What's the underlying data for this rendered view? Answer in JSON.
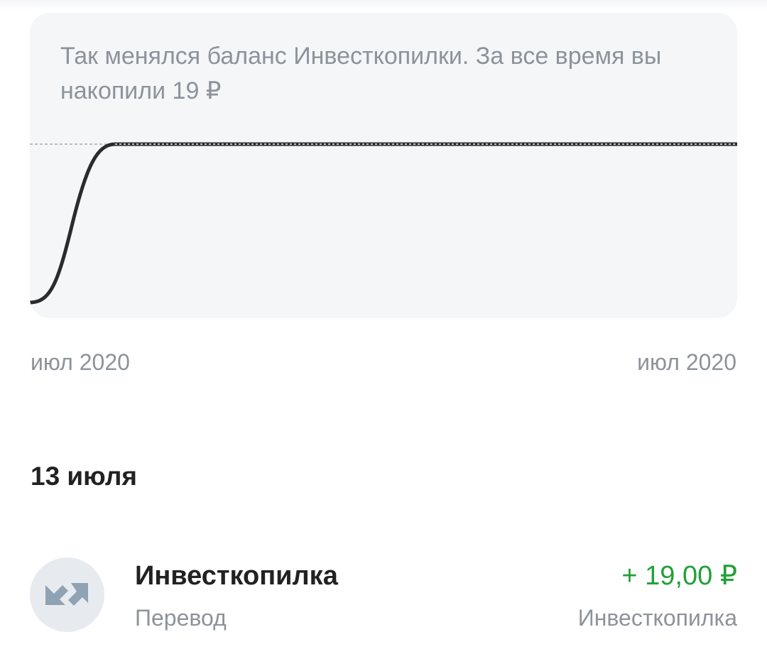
{
  "chart_card": {
    "caption": "Так менялся баланс Инвесткопилки. За все время вы накопили 19 ₽"
  },
  "chart_data": {
    "type": "line",
    "title": "",
    "x_labels": [
      "июл 2020",
      "июл 2020"
    ],
    "series": [
      {
        "values": [
          0,
          19
        ]
      }
    ],
    "ylim": [
      0,
      19
    ],
    "reference_line": 19,
    "grid": false
  },
  "section": {
    "date": "13 июля"
  },
  "operation": {
    "title": "Инвесткопилка",
    "subtitle": "Перевод",
    "amount": "+ 19,00 ₽",
    "account": "Инвесткопилка",
    "icon": "transfer-arrows-icon",
    "amount_color": "#21a038"
  },
  "colors": {
    "card_background": "#f4f6f8",
    "line": "#2b2b2b",
    "muted_text": "#8d939b",
    "icon_arrows": "#8fa3b5",
    "icon_background": "#e7ebef"
  }
}
